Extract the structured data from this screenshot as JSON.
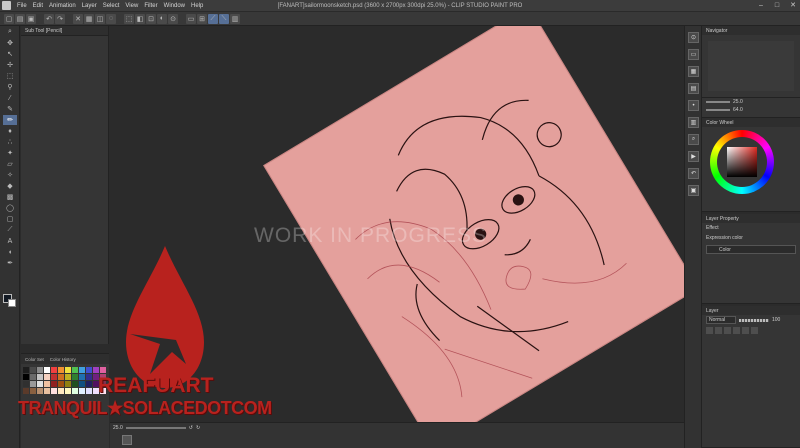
{
  "window": {
    "title": "[FANART]sailormoonsketch.psd (3600 x 2700px 300dpi 25.0%) - CLIP STUDIO PAINT PRO"
  },
  "menu": [
    "File",
    "Edit",
    "Animation",
    "Layer",
    "Select",
    "View",
    "Filter",
    "Window",
    "Help"
  ],
  "panels": {
    "sub_tool_tab": "Sub Tool [Pencil]",
    "color_set_tab": "Color Set",
    "color_history_tab": "Color History",
    "navigator": "Navigator",
    "color_wheel": "Color Wheel",
    "layer_property": "Layer Property",
    "effect_label": "Effect",
    "expression_color_label": "Expression color",
    "expression_color_value": "Color",
    "layer": "Layer",
    "blend_mode": "Normal",
    "opacity": "100"
  },
  "navigator_values": {
    "zoom": "25.0",
    "angle": "64.0"
  },
  "status": {
    "zoom": "25.0"
  },
  "canvas": {
    "watermark_text": "WORK IN PROGRESS",
    "brand": "REAFUART",
    "site": "TRANQUIL★SOLACEDOTCOM"
  },
  "colors": {
    "paper": "#e4a09c",
    "brand_red": "#b8221e",
    "accent": "#566f96"
  },
  "swatches": [
    "#1d1d1d",
    "#4b4b4b",
    "#8a8a8a",
    "#ffffff",
    "#f04040",
    "#f09030",
    "#f0e040",
    "#50c050",
    "#40a0e0",
    "#4050d0",
    "#a040c0",
    "#e060a0",
    "#000000",
    "#6a6a6a",
    "#c4c4c4",
    "#f4d0c0",
    "#c03030",
    "#d07020",
    "#c0b020",
    "#308030",
    "#2070b0",
    "#303090",
    "#702080",
    "#b04070",
    "#303030",
    "#9a9a9a",
    "#e0e0e0",
    "#f0c0a0",
    "#902020",
    "#a05010",
    "#908010",
    "#205020",
    "#105080",
    "#202060",
    "#501060",
    "#803050",
    "#5a3a2a",
    "#8a6040",
    "#b89070",
    "#e8c0a0",
    "#ffe0e0",
    "#ffe8c0",
    "#fff8c0",
    "#e0ffe0",
    "#e0f0ff",
    "#e0e0ff",
    "#f0e0ff",
    "#ffe0f0"
  ]
}
